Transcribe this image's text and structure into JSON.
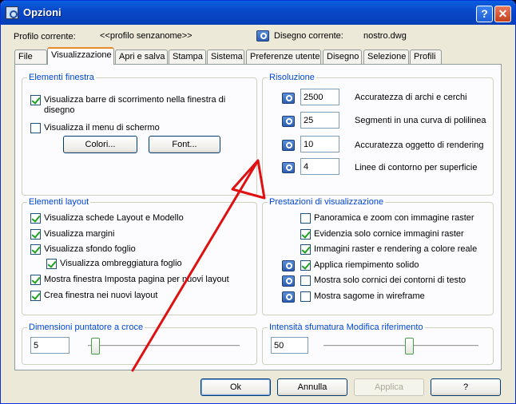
{
  "window": {
    "title": "Opzioni",
    "help": "?",
    "close": "✕"
  },
  "header": {
    "profile_label": "Profilo corrente:",
    "profile_value": "<<profilo senzanome>>",
    "drawing_label": "Disegno corrente:",
    "drawing_value": "nostro.dwg"
  },
  "tabs": [
    "File",
    "Visualizzazione",
    "Apri e salva",
    "Stampa",
    "Sistema",
    "Preferenze utente",
    "Disegno",
    "Selezione",
    "Profili"
  ],
  "active_tab": "Visualizzazione",
  "elementi_finestra": {
    "title": "Elementi finestra",
    "barre_line1": "Visualizza barre di scorrimento nella finestra di",
    "barre_line2": "disegno",
    "barre_checked": true,
    "menu_schermo": "Visualizza il menu di schermo",
    "menu_checked": false,
    "colori_btn": "Colori...",
    "font_btn": "Font..."
  },
  "risoluzione": {
    "title": "Risoluzione",
    "rows": [
      {
        "value": "2500",
        "label": "Accuratezza di archi e cerchi"
      },
      {
        "value": "25",
        "label": "Segmenti in una curva di polilinea"
      },
      {
        "value": "10",
        "label": "Accuratezza oggetto di rendering"
      },
      {
        "value": "4",
        "label": "Linee di contorno per superficie"
      }
    ]
  },
  "elementi_layout": {
    "title": "Elementi layout",
    "items": [
      {
        "label": "Visualizza schede Layout e Modello",
        "checked": true
      },
      {
        "label": "Visualizza margini",
        "checked": true
      },
      {
        "label": "Visualizza sfondo foglio",
        "checked": true
      },
      {
        "label": "Visualizza ombreggiatura foglio",
        "checked": true
      },
      {
        "label": "Mostra finestra Imposta pagina per nuovi layout",
        "checked": true
      },
      {
        "label": "Crea finestra nei nuovi layout",
        "checked": true
      }
    ]
  },
  "prestazioni": {
    "title": "Prestazioni di visualizzazione",
    "items": [
      {
        "label": "Panoramica e zoom con immagine raster",
        "checked": false
      },
      {
        "label": "Evidenzia solo cornice immagini raster",
        "checked": true
      },
      {
        "label": "Immagini raster e rendering a colore reale",
        "checked": true
      },
      {
        "label": "Applica riempimento solido",
        "checked": true
      },
      {
        "label": "Mostra solo cornici dei contorni di testo",
        "checked": false
      },
      {
        "label": "Mostra sagome in wireframe",
        "checked": false
      }
    ]
  },
  "puntatore": {
    "title": "Dimensioni puntatore a croce",
    "value": "5",
    "level": 5
  },
  "sfumatura": {
    "title": "Intensità sfumatura Modifica riferimento",
    "value": "50",
    "level": 50
  },
  "buttons": {
    "ok": "Ok",
    "annulla": "Annulla",
    "applica": "Applica",
    "help": "?"
  },
  "colors": {
    "title_bar": "#0847c8",
    "group_title": "#0046d5",
    "annotation_arrow": "#e01010"
  }
}
